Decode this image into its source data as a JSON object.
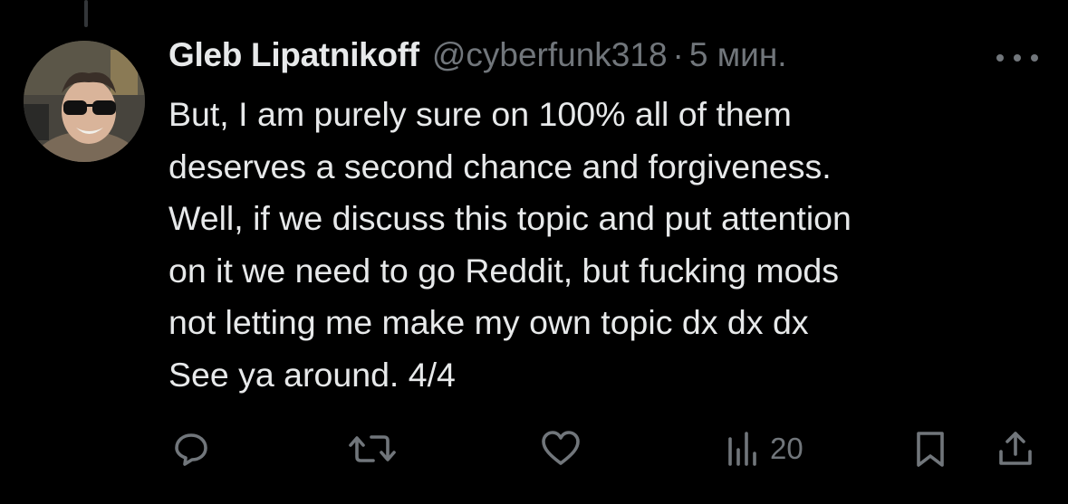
{
  "tweet": {
    "display_name": "Gleb Lipatnikoff",
    "handle": "@cyberfunk318",
    "separator": "·",
    "time": "5 мин.",
    "lines": [
      "But, I am purely sure on 100% all of them",
      "deserves a second chance and forgiveness.",
      "Well, if we discuss this topic and put attention",
      "on it we need to go Reddit, but fucking mods",
      "not letting me make my own topic dx dx dx",
      "See ya around. 4/4"
    ]
  },
  "actions": {
    "reply_icon": "reply-icon",
    "retweet_icon": "retweet-icon",
    "like_icon": "like-icon",
    "views_icon": "views-icon",
    "views_count": "20",
    "bookmark_icon": "bookmark-icon",
    "share_icon": "share-icon"
  },
  "colors": {
    "background": "#000000",
    "text": "#e7e9ea",
    "secondary": "#71767b",
    "thread_line": "#333639"
  }
}
